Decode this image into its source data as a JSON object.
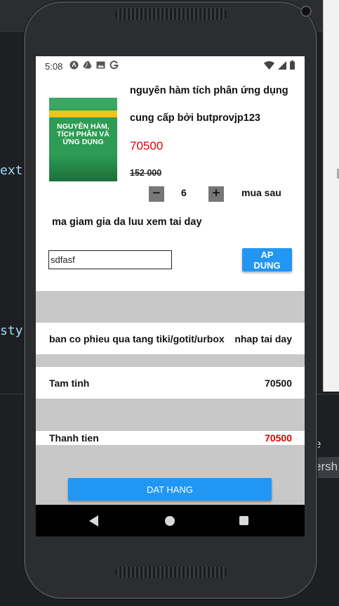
{
  "ide": {
    "code_line_1": "ext>",
    "code_line_2": "styl",
    "right_panel_letter": "e",
    "right_panel_tag": "ersh"
  },
  "status_bar": {
    "time": "5:08",
    "left_icons": [
      "a-icon",
      "drive-icon",
      "image-icon",
      "google-icon"
    ],
    "right_icons": [
      "wifi-icon",
      "signal-icon",
      "battery-icon"
    ]
  },
  "product": {
    "cover_title": "NGUYÊN HÀM, TÍCH PHÂN VÀ ỨNG DỤNG",
    "title": "nguyên hàm tích phân ứng dụng",
    "seller": "cung cấp bởi butprovjp123",
    "price": "70500",
    "old_price": "152 000",
    "quantity": "6",
    "minus_label": "−",
    "plus_label": "+",
    "buy_later": "mua sau"
  },
  "coupon": {
    "hint_text": "ma giam gia da luu xem tai day",
    "input_value": "sdfasf",
    "apply_label": "AP DUNG"
  },
  "gift": {
    "label": "ban co phieu qua tang tiki/gotit/urbox",
    "action": "nhap tai day"
  },
  "summary": {
    "subtotal_label": "Tam tinh",
    "subtotal_value": "70500",
    "total_label": "Thanh tien",
    "total_value": "70500"
  },
  "checkout": {
    "order_label": "DAT HANG"
  },
  "colors": {
    "accent": "#2196f3",
    "price_red": "#e10000",
    "divider_gray": "#c8c8c8"
  }
}
